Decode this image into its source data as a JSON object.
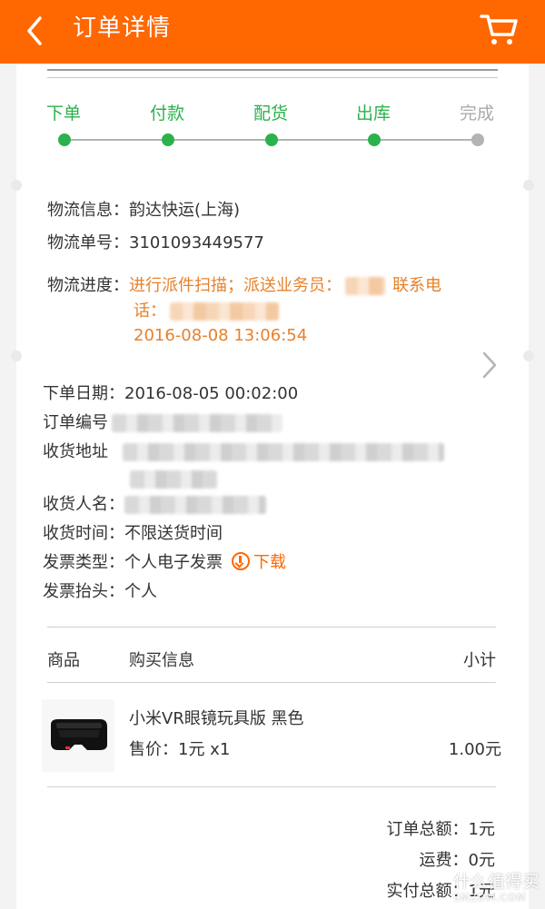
{
  "header": {
    "title": "订单详情"
  },
  "progress": {
    "steps": [
      {
        "label": "下单",
        "state": "done"
      },
      {
        "label": "付款",
        "state": "done"
      },
      {
        "label": "配货",
        "state": "done"
      },
      {
        "label": "出库",
        "state": "done"
      },
      {
        "label": "完成",
        "state": "todo"
      }
    ],
    "colors": {
      "done": "#2bb24c",
      "todo": "#b3b3b3"
    }
  },
  "logistics": {
    "carrier_label": "物流信息：",
    "carrier_value": "韵达快运(上海)",
    "tracking_label": "物流单号：",
    "tracking_value": "3101093449577",
    "progress_label": "物流进度：",
    "progress_text_1": "进行派件扫描；派送业务员：",
    "progress_text_2": "联系电",
    "progress_text_3": "话：",
    "progress_time": "2016-08-08 13:06:54"
  },
  "order": {
    "date_label": "下单日期：",
    "date_value": "2016-08-05 00:02:00",
    "number_label": "订单编号",
    "address_label": "收货地址",
    "receiver_label": "收货人名：",
    "delivery_label": "收货时间：",
    "delivery_value": "不限送货时间",
    "invoice_type_label": "发票类型：",
    "invoice_type_value": "个人电子发票",
    "download_label": "下载",
    "invoice_title_label": "发票抬头：",
    "invoice_title_value": "个人"
  },
  "table": {
    "col_goods": "商品",
    "col_info": "购买信息",
    "col_subtotal": "小计"
  },
  "product": {
    "name": "小米VR眼镜玩具版 黑色",
    "price_line": "售价：1元 x1",
    "subtotal": "1.00元"
  },
  "totals": {
    "order_total": "订单总额：1元",
    "shipping": "运费：0元",
    "paid": "实付总额：1元"
  },
  "watermark": {
    "line1": "什么值得买",
    "line2": "SMZDM.COM"
  },
  "colors": {
    "accent": "#ff6700",
    "status_orange": "#e8812a"
  }
}
